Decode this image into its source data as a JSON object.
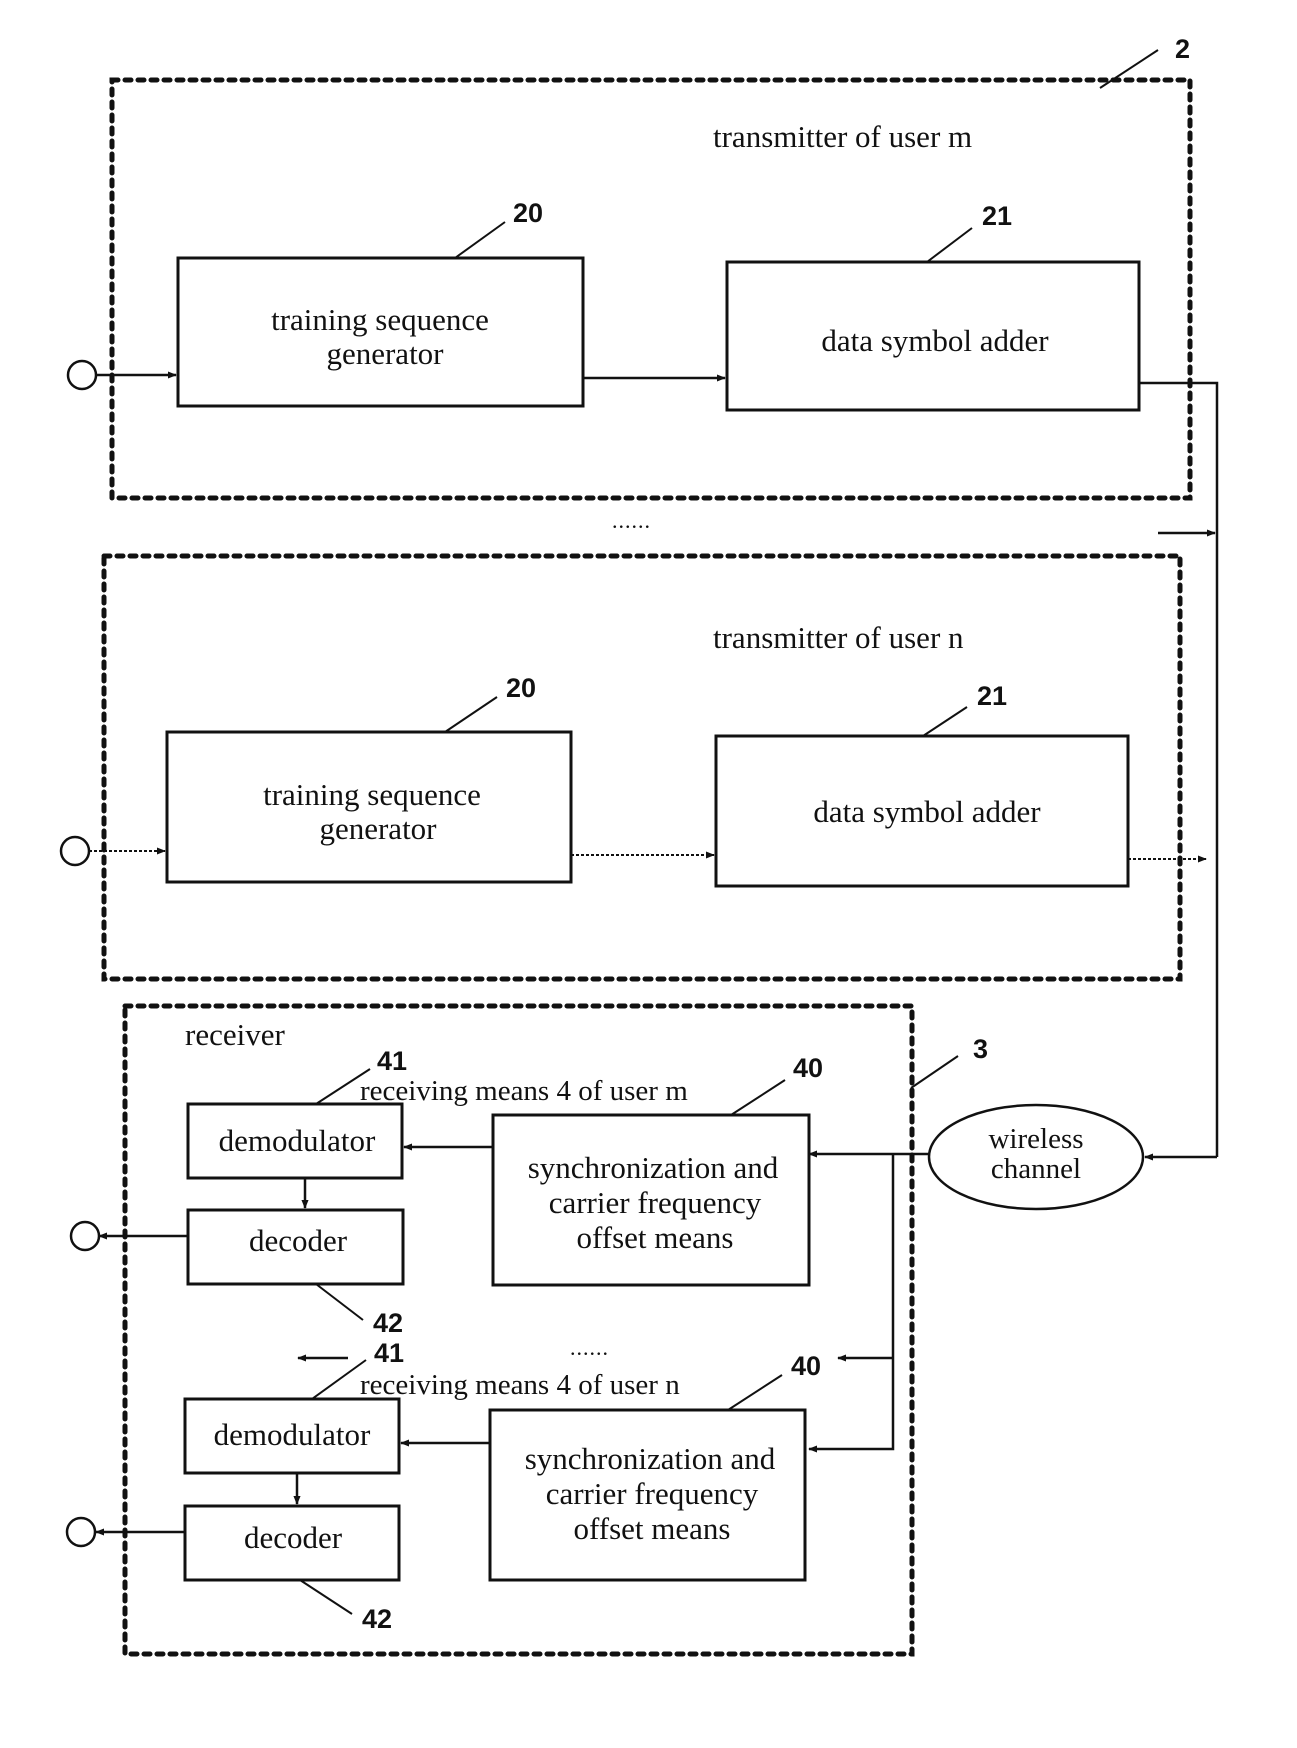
{
  "figure": {
    "reference_numbers": {
      "transmitter_system": "2",
      "receiver": "3",
      "training_sequence_generator": "20",
      "data_symbol_adder": "21",
      "sync_cfo_means": "40",
      "demodulator": "41",
      "decoder": "42"
    },
    "transmitters": [
      {
        "title": "transmitter of user m",
        "ref_tsg": "20",
        "ref_dsa": "21",
        "tsg_label_lines": [
          "training sequence",
          "generator"
        ],
        "dsa_label": "data symbol adder"
      },
      {
        "title": "transmitter of user n",
        "ref_tsg": "20",
        "ref_dsa": "21",
        "tsg_label_lines": [
          "training sequence",
          "generator"
        ],
        "dsa_label": "data symbol adder"
      }
    ],
    "between_transmitters_ellipsis": "......",
    "channel": {
      "label_lines": [
        "wireless",
        "channel"
      ]
    },
    "receiver": {
      "title": "receiver",
      "ref": "3",
      "between_units_ellipsis": "......",
      "units": [
        {
          "caption": "receiving means 4 of user m",
          "ref_sync": "40",
          "ref_demod": "41",
          "ref_decoder": "42",
          "demod_label": "demodulator",
          "decoder_label": "decoder",
          "sync_label_lines": [
            "synchronization and",
            "carrier frequency",
            "offset means"
          ]
        },
        {
          "caption": "receiving means 4 of user n",
          "ref_sync": "40",
          "ref_demod": "41",
          "ref_decoder": "42",
          "demod_label": "demodulator",
          "decoder_label": "decoder",
          "sync_label_lines": [
            "synchronization and",
            "carrier frequency",
            "offset means"
          ]
        }
      ]
    }
  }
}
